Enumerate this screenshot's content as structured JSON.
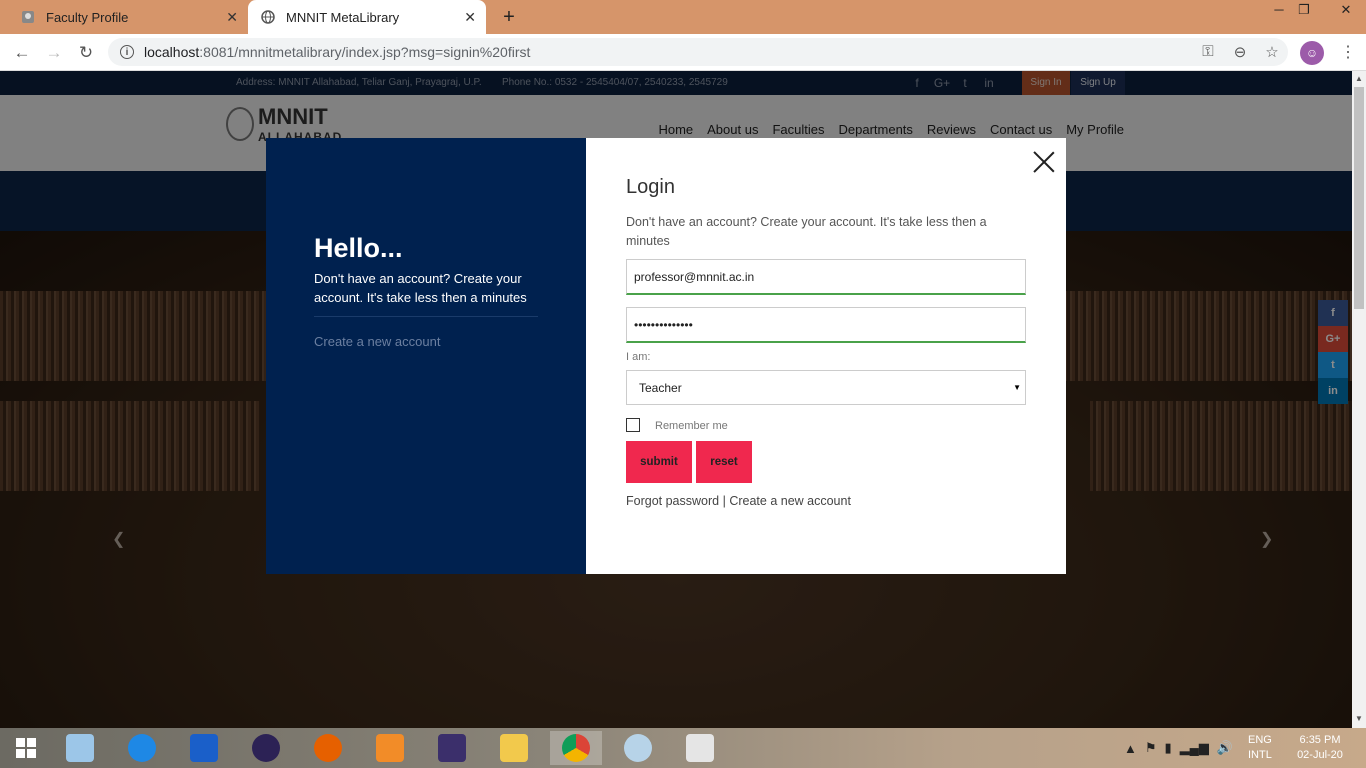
{
  "browser": {
    "tabs": [
      {
        "title": "Faculty Profile",
        "icon": "page-icon",
        "active": false
      },
      {
        "title": "MNNIT MetaLibrary",
        "icon": "globe-icon",
        "active": true
      }
    ],
    "url_host": "localhost",
    "url_path": ":8081/mnnitmetalibrary/index.jsp?msg=signin%20first"
  },
  "site": {
    "address": "Address: MNNIT Allahabad, Teliar Ganj, Prayagraj, U.P.",
    "phone": "Phone No.: 0532 - 2545404/07, 2540233, 2545729",
    "signin": "Sign In",
    "signup": "Sign Up",
    "logo_line1": "MNNIT",
    "logo_line2": "ALLAHABAD",
    "menu": [
      "Home",
      "About us",
      "Faculties",
      "Departments",
      "Reviews",
      "Contact us",
      "My Profile"
    ]
  },
  "modal": {
    "hello": "Hello...",
    "hello_sub": "Don't have an account? Create your account. It's take less then a minutes",
    "create_left": "Create a new account",
    "title": "Login",
    "description": "Don't have an account? Create your account. It's take less then a minutes",
    "email_value": "professor@mnnit.ac.in",
    "password_value": "••••••••••••••",
    "role_label": "I am:",
    "role_value": "Teacher",
    "remember_label": "Remember me",
    "submit_label": "submit",
    "reset_label": "reset",
    "forgot_label": "Forgot password",
    "separator": "|",
    "create_label": "Create a new account"
  },
  "social_side": [
    "f",
    "G+",
    "t",
    "in"
  ],
  "colors": {
    "accent": "#f0284e",
    "navy": "#00214f",
    "input_valid": "#4aa24a",
    "signin_bg": "#b5532d"
  },
  "taskbar": {
    "lang": "ENG",
    "layout": "INTL",
    "time": "6:35 PM",
    "date": "02-Jul-20"
  }
}
